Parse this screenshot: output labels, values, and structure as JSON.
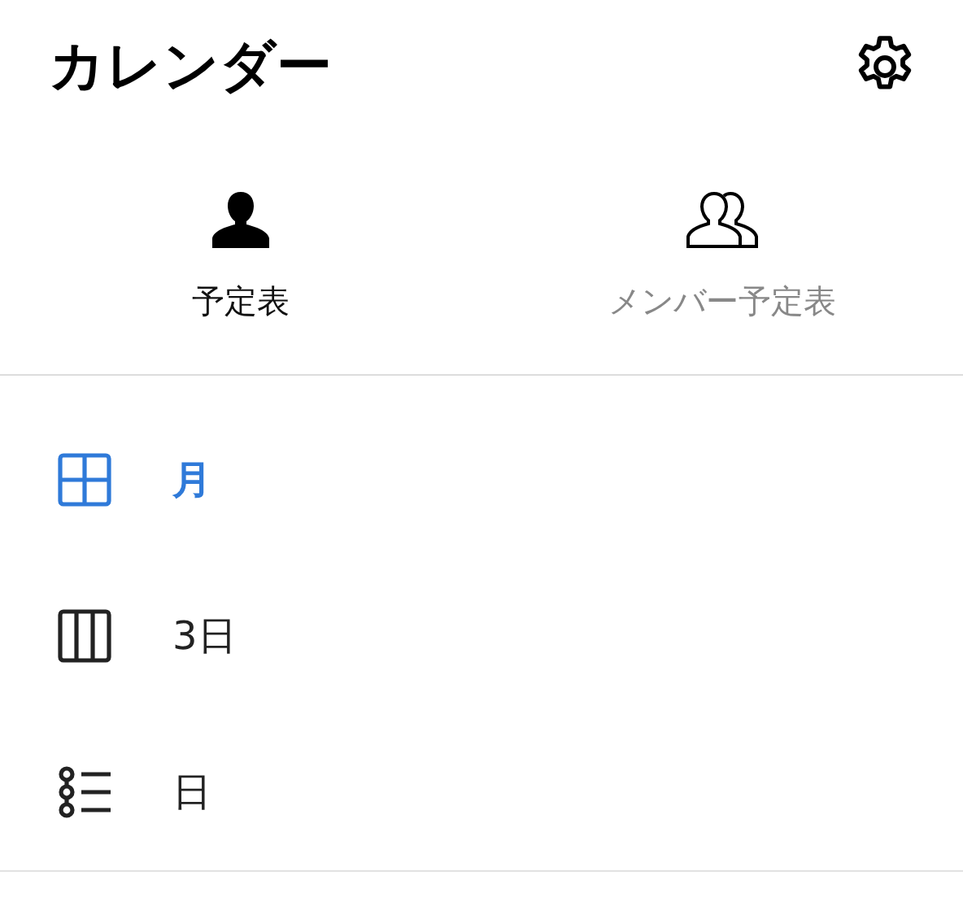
{
  "title": "カレンダー",
  "tabs": [
    {
      "label": "予定表",
      "kind": "personal",
      "selected": true
    },
    {
      "label": "メンバー予定表",
      "kind": "members",
      "selected": false
    }
  ],
  "views": [
    {
      "label": "月",
      "kind": "month",
      "selected": true
    },
    {
      "label": "3日",
      "kind": "three-day",
      "selected": false
    },
    {
      "label": "日",
      "kind": "day",
      "selected": false
    }
  ]
}
